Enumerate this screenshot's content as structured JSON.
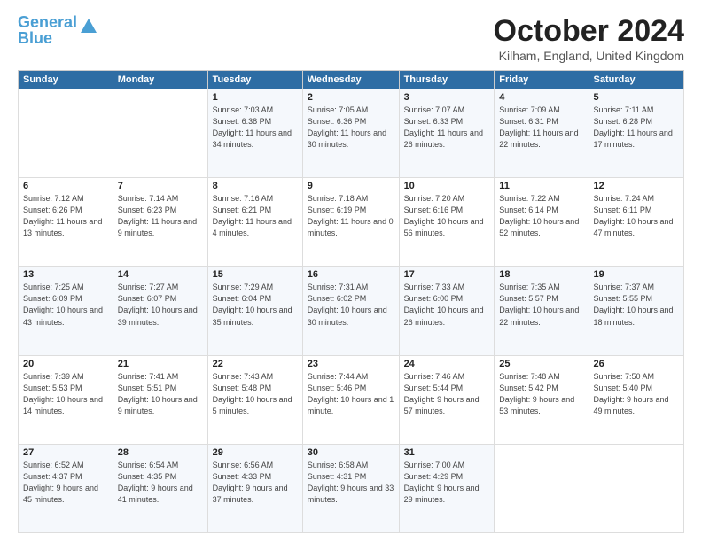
{
  "logo": {
    "line1": "General",
    "line2": "Blue"
  },
  "title": "October 2024",
  "location": "Kilham, England, United Kingdom",
  "days_of_week": [
    "Sunday",
    "Monday",
    "Tuesday",
    "Wednesday",
    "Thursday",
    "Friday",
    "Saturday"
  ],
  "weeks": [
    [
      {
        "day": "",
        "info": ""
      },
      {
        "day": "",
        "info": ""
      },
      {
        "day": "1",
        "info": "Sunrise: 7:03 AM\nSunset: 6:38 PM\nDaylight: 11 hours\nand 34 minutes."
      },
      {
        "day": "2",
        "info": "Sunrise: 7:05 AM\nSunset: 6:36 PM\nDaylight: 11 hours\nand 30 minutes."
      },
      {
        "day": "3",
        "info": "Sunrise: 7:07 AM\nSunset: 6:33 PM\nDaylight: 11 hours\nand 26 minutes."
      },
      {
        "day": "4",
        "info": "Sunrise: 7:09 AM\nSunset: 6:31 PM\nDaylight: 11 hours\nand 22 minutes."
      },
      {
        "day": "5",
        "info": "Sunrise: 7:11 AM\nSunset: 6:28 PM\nDaylight: 11 hours\nand 17 minutes."
      }
    ],
    [
      {
        "day": "6",
        "info": "Sunrise: 7:12 AM\nSunset: 6:26 PM\nDaylight: 11 hours\nand 13 minutes."
      },
      {
        "day": "7",
        "info": "Sunrise: 7:14 AM\nSunset: 6:23 PM\nDaylight: 11 hours\nand 9 minutes."
      },
      {
        "day": "8",
        "info": "Sunrise: 7:16 AM\nSunset: 6:21 PM\nDaylight: 11 hours\nand 4 minutes."
      },
      {
        "day": "9",
        "info": "Sunrise: 7:18 AM\nSunset: 6:19 PM\nDaylight: 11 hours\nand 0 minutes."
      },
      {
        "day": "10",
        "info": "Sunrise: 7:20 AM\nSunset: 6:16 PM\nDaylight: 10 hours\nand 56 minutes."
      },
      {
        "day": "11",
        "info": "Sunrise: 7:22 AM\nSunset: 6:14 PM\nDaylight: 10 hours\nand 52 minutes."
      },
      {
        "day": "12",
        "info": "Sunrise: 7:24 AM\nSunset: 6:11 PM\nDaylight: 10 hours\nand 47 minutes."
      }
    ],
    [
      {
        "day": "13",
        "info": "Sunrise: 7:25 AM\nSunset: 6:09 PM\nDaylight: 10 hours\nand 43 minutes."
      },
      {
        "day": "14",
        "info": "Sunrise: 7:27 AM\nSunset: 6:07 PM\nDaylight: 10 hours\nand 39 minutes."
      },
      {
        "day": "15",
        "info": "Sunrise: 7:29 AM\nSunset: 6:04 PM\nDaylight: 10 hours\nand 35 minutes."
      },
      {
        "day": "16",
        "info": "Sunrise: 7:31 AM\nSunset: 6:02 PM\nDaylight: 10 hours\nand 30 minutes."
      },
      {
        "day": "17",
        "info": "Sunrise: 7:33 AM\nSunset: 6:00 PM\nDaylight: 10 hours\nand 26 minutes."
      },
      {
        "day": "18",
        "info": "Sunrise: 7:35 AM\nSunset: 5:57 PM\nDaylight: 10 hours\nand 22 minutes."
      },
      {
        "day": "19",
        "info": "Sunrise: 7:37 AM\nSunset: 5:55 PM\nDaylight: 10 hours\nand 18 minutes."
      }
    ],
    [
      {
        "day": "20",
        "info": "Sunrise: 7:39 AM\nSunset: 5:53 PM\nDaylight: 10 hours\nand 14 minutes."
      },
      {
        "day": "21",
        "info": "Sunrise: 7:41 AM\nSunset: 5:51 PM\nDaylight: 10 hours\nand 9 minutes."
      },
      {
        "day": "22",
        "info": "Sunrise: 7:43 AM\nSunset: 5:48 PM\nDaylight: 10 hours\nand 5 minutes."
      },
      {
        "day": "23",
        "info": "Sunrise: 7:44 AM\nSunset: 5:46 PM\nDaylight: 10 hours\nand 1 minute."
      },
      {
        "day": "24",
        "info": "Sunrise: 7:46 AM\nSunset: 5:44 PM\nDaylight: 9 hours\nand 57 minutes."
      },
      {
        "day": "25",
        "info": "Sunrise: 7:48 AM\nSunset: 5:42 PM\nDaylight: 9 hours\nand 53 minutes."
      },
      {
        "day": "26",
        "info": "Sunrise: 7:50 AM\nSunset: 5:40 PM\nDaylight: 9 hours\nand 49 minutes."
      }
    ],
    [
      {
        "day": "27",
        "info": "Sunrise: 6:52 AM\nSunset: 4:37 PM\nDaylight: 9 hours\nand 45 minutes."
      },
      {
        "day": "28",
        "info": "Sunrise: 6:54 AM\nSunset: 4:35 PM\nDaylight: 9 hours\nand 41 minutes."
      },
      {
        "day": "29",
        "info": "Sunrise: 6:56 AM\nSunset: 4:33 PM\nDaylight: 9 hours\nand 37 minutes."
      },
      {
        "day": "30",
        "info": "Sunrise: 6:58 AM\nSunset: 4:31 PM\nDaylight: 9 hours\nand 33 minutes."
      },
      {
        "day": "31",
        "info": "Sunrise: 7:00 AM\nSunset: 4:29 PM\nDaylight: 9 hours\nand 29 minutes."
      },
      {
        "day": "",
        "info": ""
      },
      {
        "day": "",
        "info": ""
      }
    ]
  ]
}
